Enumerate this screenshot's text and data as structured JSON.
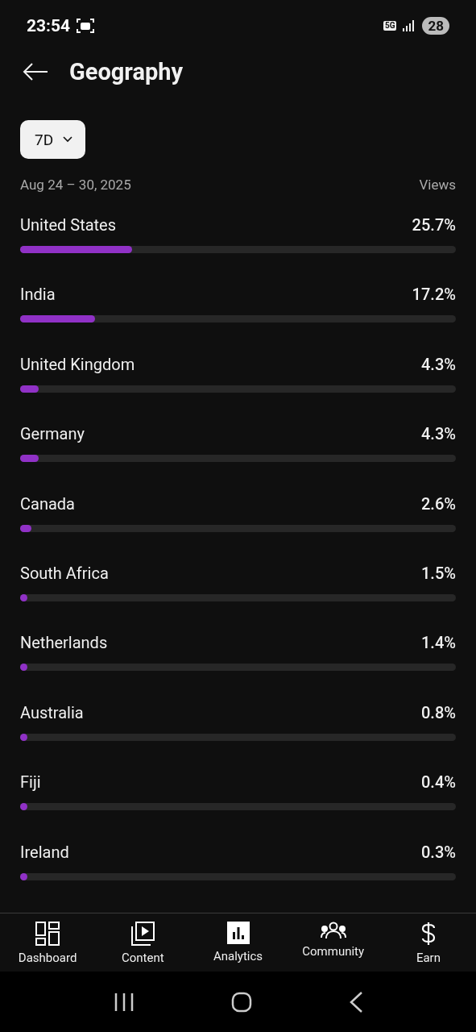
{
  "status_bar": {
    "time": "23:54",
    "network": "5G",
    "battery": "28"
  },
  "header": {
    "title": "Geography"
  },
  "period_dropdown": {
    "value": "7D"
  },
  "date_range": "Aug 24 – 30, 2025",
  "metric_label": "Views",
  "countries": [
    {
      "name": "United States",
      "value": "25.7%",
      "level": 0.257
    },
    {
      "name": "India",
      "value": "17.2%",
      "level": 0.172
    },
    {
      "name": "United Kingdom",
      "value": "4.3%",
      "level": 0.043
    },
    {
      "name": "Germany",
      "value": "4.3%",
      "level": 0.043
    },
    {
      "name": "Canada",
      "value": "2.6%",
      "level": 0.026
    },
    {
      "name": "South Africa",
      "value": "1.5%",
      "level": 0.015
    },
    {
      "name": "Netherlands",
      "value": "1.4%",
      "level": 0.014
    },
    {
      "name": "Australia",
      "value": "0.8%",
      "level": 0.008
    },
    {
      "name": "Fiji",
      "value": "0.4%",
      "level": 0.004
    },
    {
      "name": "Ireland",
      "value": "0.3%",
      "level": 0.003
    }
  ],
  "bottom_nav": [
    {
      "label": "Dashboard",
      "selected": false
    },
    {
      "label": "Content",
      "selected": false
    },
    {
      "label": "Analytics",
      "selected": true
    },
    {
      "label": "Community",
      "selected": false
    },
    {
      "label": "Earn",
      "selected": false
    }
  ]
}
